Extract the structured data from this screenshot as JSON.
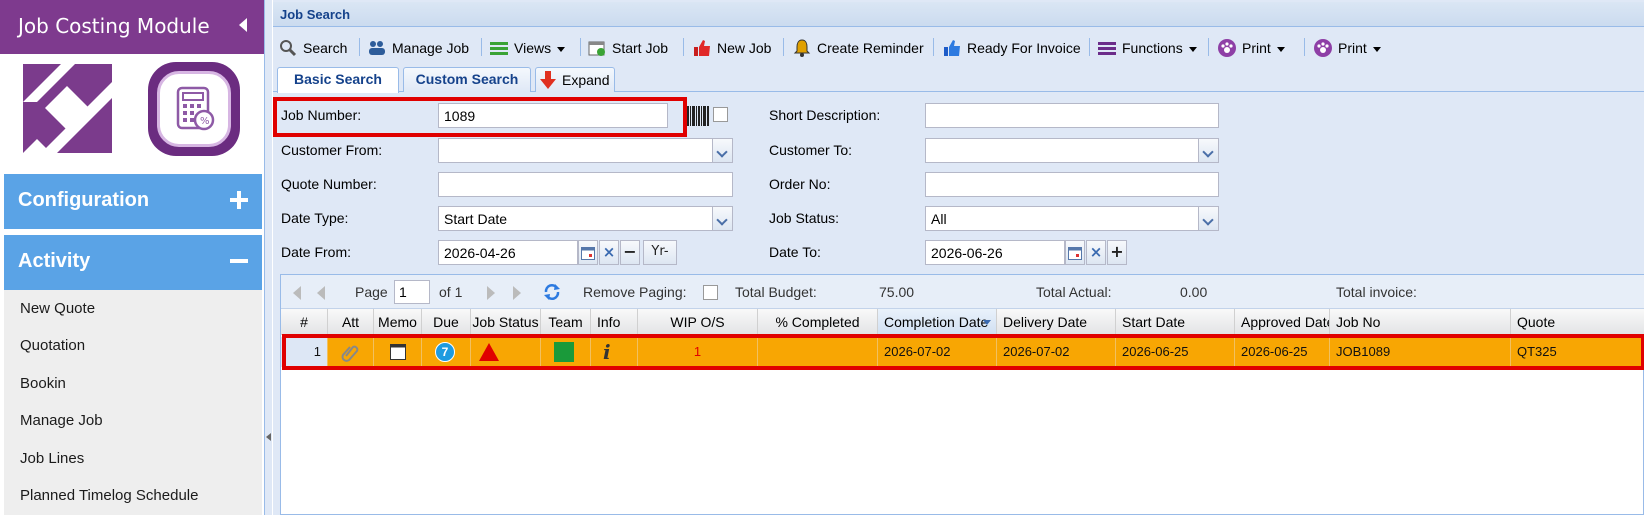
{
  "sidebar": {
    "title": "Job Costing Module",
    "sections": [
      {
        "label": "Configuration",
        "state": "collapsed"
      },
      {
        "label": "Activity",
        "state": "expanded"
      }
    ],
    "items": [
      "New Quote",
      "Quotation",
      "Bookin",
      "Manage Job",
      "Job Lines",
      "Planned Timelog Schedule"
    ]
  },
  "panel": {
    "title": "Job Search"
  },
  "toolbar": {
    "search": "Search",
    "manage_job": "Manage Job",
    "views": "Views",
    "start_job": "Start Job",
    "new_job": "New Job",
    "create_reminder": "Create Reminder",
    "ready_for_invoice": "Ready For Invoice",
    "functions": "Functions",
    "print1": "Print",
    "print2": "Print"
  },
  "tabs": {
    "basic": "Basic Search",
    "custom": "Custom Search",
    "expand": "Expand"
  },
  "form": {
    "job_number_label": "Job Number:",
    "job_number_value": "1089",
    "short_desc_label": "Short Description:",
    "short_desc_value": "",
    "customer_from_label": "Customer From:",
    "customer_from_value": "",
    "customer_to_label": "Customer To:",
    "customer_to_value": "",
    "quote_number_label": "Quote Number:",
    "quote_number_value": "",
    "order_no_label": "Order No:",
    "order_no_value": "",
    "date_type_label": "Date Type:",
    "date_type_value": "Start Date",
    "job_status_label": "Job Status:",
    "job_status_value": "All",
    "date_from_label": "Date From:",
    "date_from_value": "2026-04-26",
    "yr_label": "Yr-",
    "date_to_label": "Date To:",
    "date_to_value": "2026-06-26"
  },
  "pager": {
    "page_label": "Page",
    "page_value": "1",
    "of_label": "of 1",
    "remove_paging_label": "Remove Paging:",
    "total_budget_label": "Total Budget:",
    "total_budget_value": "75.00",
    "total_actual_label": "Total Actual:",
    "total_actual_value": "0.00",
    "total_invoice_label": "Total invoice:"
  },
  "grid": {
    "columns": [
      "#",
      "Att",
      "Memo",
      "Due",
      "Job Status",
      "Team",
      "Info",
      "WIP O/S",
      "% Completed",
      "Completion Date",
      "Delivery Date",
      "Start Date",
      "Approved Date",
      "Job No",
      "Quote"
    ],
    "row": {
      "num": "1",
      "due": "7",
      "wip": "1",
      "completed": "",
      "completion_date": "2026-07-02",
      "delivery_date": "2026-07-02",
      "start_date": "2026-06-25",
      "approved_date": "2026-06-25",
      "job_no": "JOB1089",
      "quote": "QT325"
    }
  },
  "colors": {
    "sidebar_header": "#7e3a8e",
    "accordion": "#5aa3e6",
    "row_highlight": "#f8a603",
    "annotation_red": "#e00000",
    "team_green": "#1a9a3a",
    "status_red": "#e00000"
  }
}
